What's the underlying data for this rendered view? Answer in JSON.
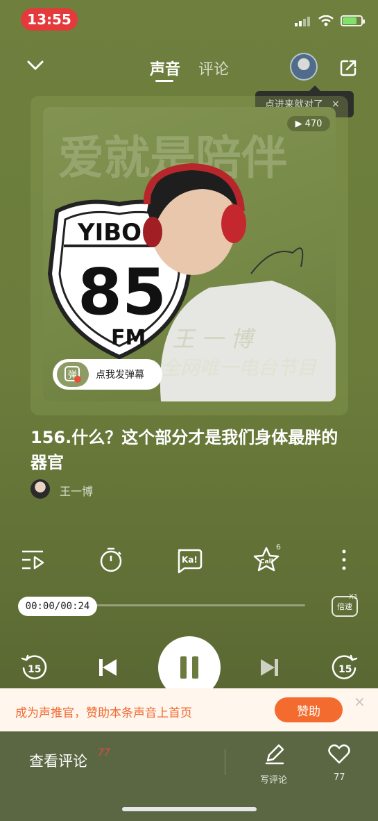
{
  "status_bar": {
    "time": "13:55",
    "battery_level": 0.75
  },
  "header": {
    "tabs": [
      {
        "label": "声音",
        "active": true
      },
      {
        "label": "评论",
        "active": false
      }
    ],
    "tooltip": {
      "text": "点进来就对了",
      "close": "×"
    }
  },
  "cover": {
    "play_count": "470",
    "headline": "爱就是陪伴",
    "sign_top": "YIBO",
    "sign_number": "85",
    "sign_bottom": "FM",
    "host_text": "王 一 博",
    "tagline": "全网唯一电台节目",
    "danmaku_icon": "弹",
    "danmaku_label": "点我发弹幕"
  },
  "track": {
    "title": "156.什么？这个部分才是我们身体最胖的器官",
    "author": "王一博"
  },
  "tools": {
    "call_count": "6",
    "ka_label": "Ka!",
    "call_label": "Call"
  },
  "progress": {
    "time_label": "00:00/00:24",
    "fraction": 0.0,
    "speed_label": "倍速",
    "speed_value": "X1"
  },
  "controls": {
    "rewind_label": "15",
    "forward_label": "15"
  },
  "promo": {
    "text": "成为声推官，赞助本条声音上首页",
    "button": "赞助",
    "close": "×"
  },
  "bottom_bar": {
    "comments_label": "查看评论",
    "comments_count": "77",
    "write_label": "写评论",
    "like_count": "77"
  },
  "colors": {
    "accent": "#f36b2f",
    "background": "#6e7f3e",
    "time_pill": "#e6393b"
  }
}
